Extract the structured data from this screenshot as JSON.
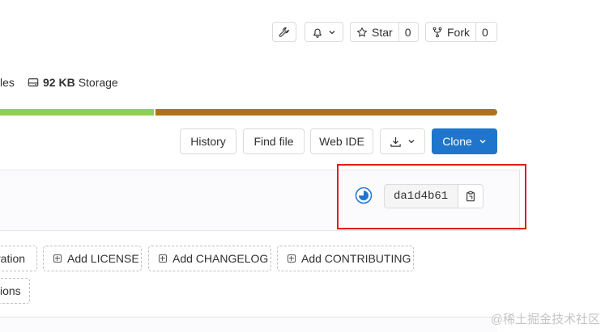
{
  "header": {
    "star_label": "Star",
    "star_count": "0",
    "fork_label": "Fork",
    "fork_count": "0"
  },
  "stats": {
    "files_partial": "les",
    "storage_value": "92 KB",
    "storage_label": "Storage"
  },
  "language_bar": {
    "segments": [
      {
        "color": "#8fd14f",
        "share": 0.3
      },
      {
        "color": "#b07219",
        "share": 0.7
      }
    ]
  },
  "toolbar": {
    "history": "History",
    "find_file": "Find file",
    "web_ide": "Web IDE",
    "clone": "Clone"
  },
  "commit": {
    "sha": "da1d4b61"
  },
  "actions": {
    "partial_left": "ration",
    "add_license": "Add LICENSE",
    "add_changelog": "Add CHANGELOG",
    "add_contributing": "Add CONTRIBUTING",
    "partial_left_2": "ions"
  },
  "watermark": "@稀土掘金技术社区",
  "colors": {
    "accent": "#1f75cb",
    "highlight": "#e11d1d"
  }
}
